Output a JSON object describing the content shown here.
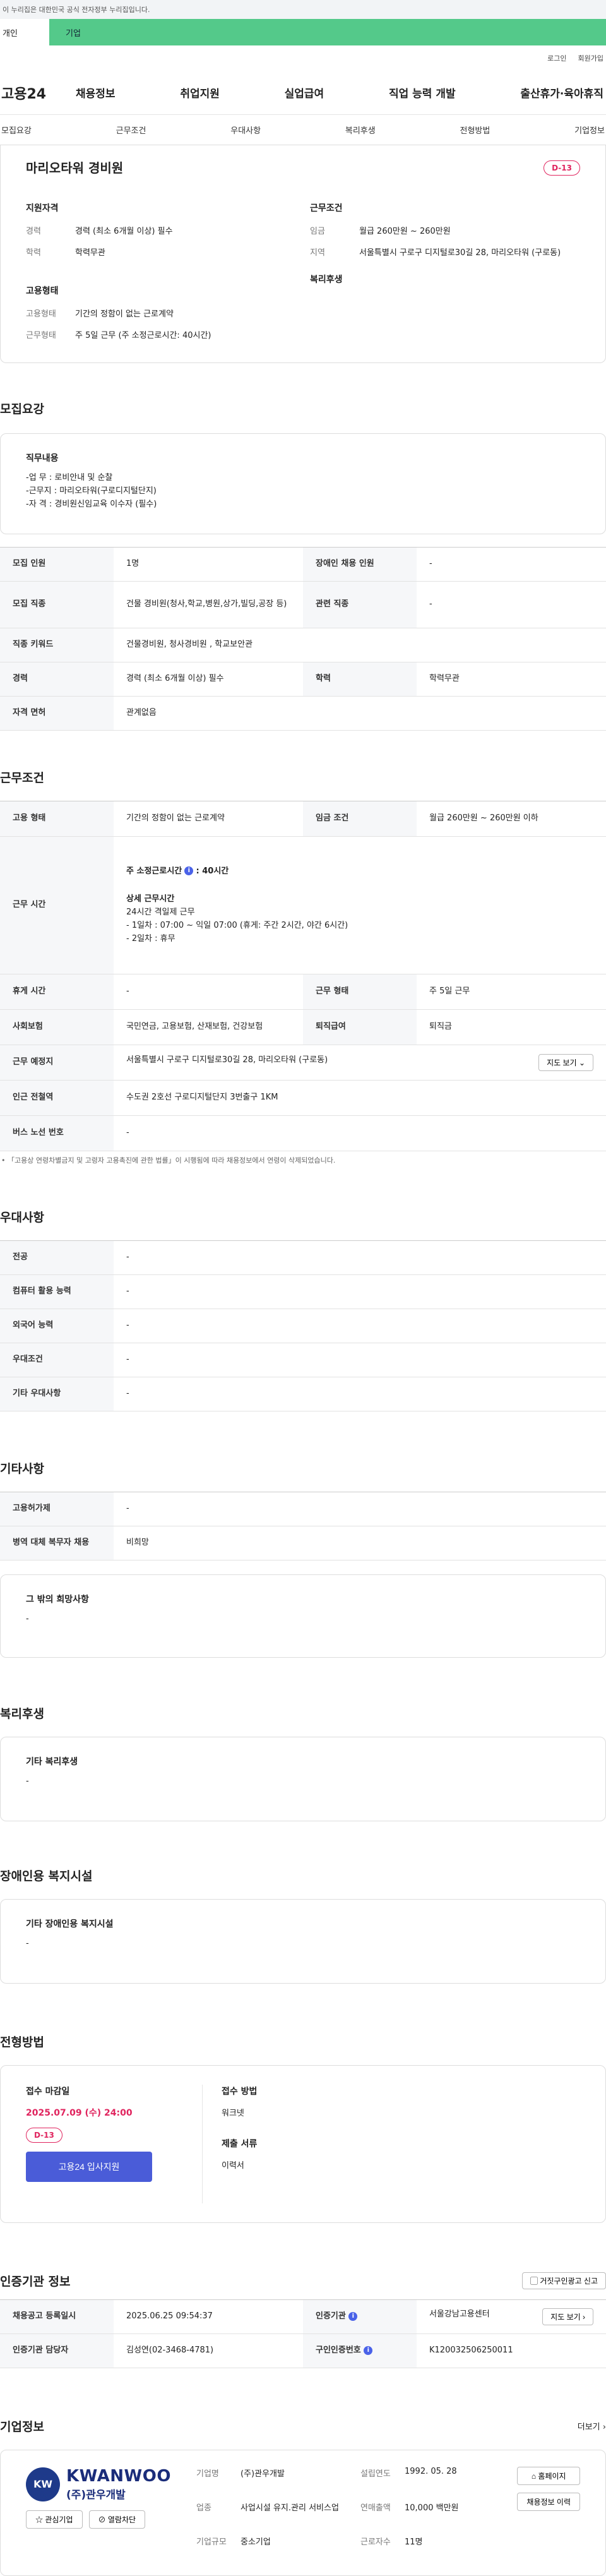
{
  "gov_notice": "이 누리집은 대한민국 공식 전자정부 누리집입니다.",
  "top_tabs": [
    "개인",
    "기업"
  ],
  "util_links": [
    "로그인",
    "회원가입"
  ],
  "logo": "고용24",
  "gnb": [
    "채용정보",
    "취업지원",
    "실업급여",
    "직업 능력 개발",
    "출산휴가·육아휴직"
  ],
  "anchors": [
    "모집요강",
    "근무조건",
    "우대사항",
    "복리후생",
    "전형방법",
    "기업정보"
  ],
  "summary": {
    "title": "마리오타워 경비원",
    "dday": "D-13",
    "qual_title": "지원자격",
    "career_k": "경력",
    "career_v": "경력 (최소 6개월 이상) 필수",
    "edu_k": "학력",
    "edu_v": "학력무관",
    "emp_title": "고용형태",
    "emp_k": "고용형태",
    "emp_v": "기간의 정함이 없는 근로계약",
    "hours_k": "근무형태",
    "hours_v": "주 5일 근무 (주 소정근로시간: 40시간)",
    "cond_title": "근무조건",
    "wage_k": "임금",
    "wage_v": "월급 260만원 ~ 260만원",
    "area_k": "지역",
    "area_v": "서울특별시 구로구 디지털로30길 28, 마리오타워 (구로동)",
    "welfare_title": "복리후생"
  },
  "recruit": {
    "title": "모집요강",
    "duty_title": "직무내용",
    "duty_lines": [
      "-업    무 : 로비안내 및 순찰",
      "-근무지 : 마리오타워(구로디지털단지)",
      "-자    격 : 경비원신임교육 이수자 (필수)"
    ],
    "rows": [
      [
        "모집 인원",
        "1명",
        "장애인 채용 인원",
        "-"
      ],
      [
        "모집 직종",
        "건물 경비원(청사,학교,병원,상가,빌딩,공장 등)",
        "관련 직종",
        "-"
      ],
      [
        "직종 키워드",
        "건물경비원, 청사경비원 , 학교보안관",
        "",
        ""
      ],
      [
        "경력",
        "경력 (최소 6개월 이상) 필수",
        "학력",
        "학력무관"
      ],
      [
        "자격 면허",
        "관계없음",
        "",
        ""
      ]
    ]
  },
  "work": {
    "title": "근무조건",
    "emp_th": "고용 형태",
    "emp_v": "기간의 정함이 없는 근로계약",
    "wage_th": "임금 조건",
    "wage_v": "월급 260만원 ~ 260만원 이하",
    "hours_th": "근무 시간",
    "hours_main": "주 소정근로시간",
    "hours_main_v": ": 40시간",
    "hours_detail_title": "상세 근무시간",
    "hours_detail": [
      "24시간 격일제 근무",
      "- 1일차 : 07:00 ~ 익일 07:00 (휴게: 주간 2시간, 야간 6시간)",
      "- 2일차 : 휴무"
    ],
    "rest_th": "휴게 시간",
    "rest_v": "-",
    "type_th": "근무 형태",
    "type_v": "주 5일 근무",
    "ins_th": "사회보험",
    "ins_v": "국민연금, 고용보험, 산재보험, 건강보험",
    "sev_th": "퇴직급여",
    "sev_v": "퇴직금",
    "place_th": "근무 예정지",
    "place_v": "서울특별시 구로구 디지털로30길 28, 마리오타워 (구로동)",
    "map_btn": "지도 보기",
    "subway_th": "인근 전철역",
    "subway_v": "수도권 2호선 구로디지털단지 3번출구 1KM",
    "bus_th": "버스 노선 번호",
    "bus_v": "-",
    "note": "「고용상 연령차별금지 및 고령자 고용촉진에 관한 법률」이 시행됨에 따라 채용정보에서 연령이 삭제되었습니다."
  },
  "pref": {
    "title": "우대사항",
    "rows": [
      [
        "전공",
        "-"
      ],
      [
        "컴퓨터 활용 능력",
        "-"
      ],
      [
        "외국어 능력",
        "-"
      ],
      [
        "우대조건",
        "-"
      ],
      [
        "기타 우대사항",
        "-"
      ]
    ]
  },
  "etc": {
    "title": "기타사항",
    "rows": [
      [
        "고용허가제",
        "-"
      ],
      [
        "병역 대체 복무자 채용",
        "비희망"
      ]
    ],
    "wish_title": "그 밖의 희망사항",
    "wish_v": "-"
  },
  "welfare": {
    "title": "복리후생",
    "box_title": "기타 복리후생",
    "box_v": "-"
  },
  "disabled": {
    "title": "장애인용 복지시설",
    "box_title": "기타 장애인용 복지시설",
    "box_v": "-"
  },
  "process": {
    "title": "전형방법",
    "deadline_title": "접수 마감일",
    "deadline": "2025.07.09 (수) 24:00",
    "dday": "D-13",
    "apply": "고용24 입사지원",
    "method_title": "접수 방법",
    "method_v": "워크넷",
    "docs_title": "제출 서류",
    "docs_v": "이력서"
  },
  "agency": {
    "title": "인증기관 정보",
    "report_btn": "거짓구인광고 신고",
    "reg_th": "채용공고 등록일시",
    "reg_v": "2025.06.25 09:54:37",
    "inst_th": "인증기관",
    "inst_v": "서울강남고용센터",
    "map_btn": "지도 보기",
    "mgr_th": "인증기관 담당자",
    "mgr_v": "김성연(02-3468-4781)",
    "no_th": "구인인증번호",
    "no_v": "K120032506250011"
  },
  "company": {
    "title": "기업정보",
    "more": "더보기",
    "logo_en": "KWANWOO",
    "logo_ko": "(주)관우개발",
    "fav_btn": "관심기업",
    "block_btn": "열람차단",
    "name_k": "기업명",
    "name_v": "(주)관우개발",
    "biz_k": "업종",
    "biz_v": "사업시설 유지.관리 서비스업",
    "size_k": "기업규모",
    "size_v": "중소기업",
    "est_k": "설립연도",
    "est_v": "1992. 05. 28",
    "sales_k": "연매출액",
    "sales_v": "10,000 백만원",
    "emp_k": "근로자수",
    "emp_v": "11명",
    "home_btn": "홈페이지",
    "history_btn": "채용정보 이력"
  }
}
